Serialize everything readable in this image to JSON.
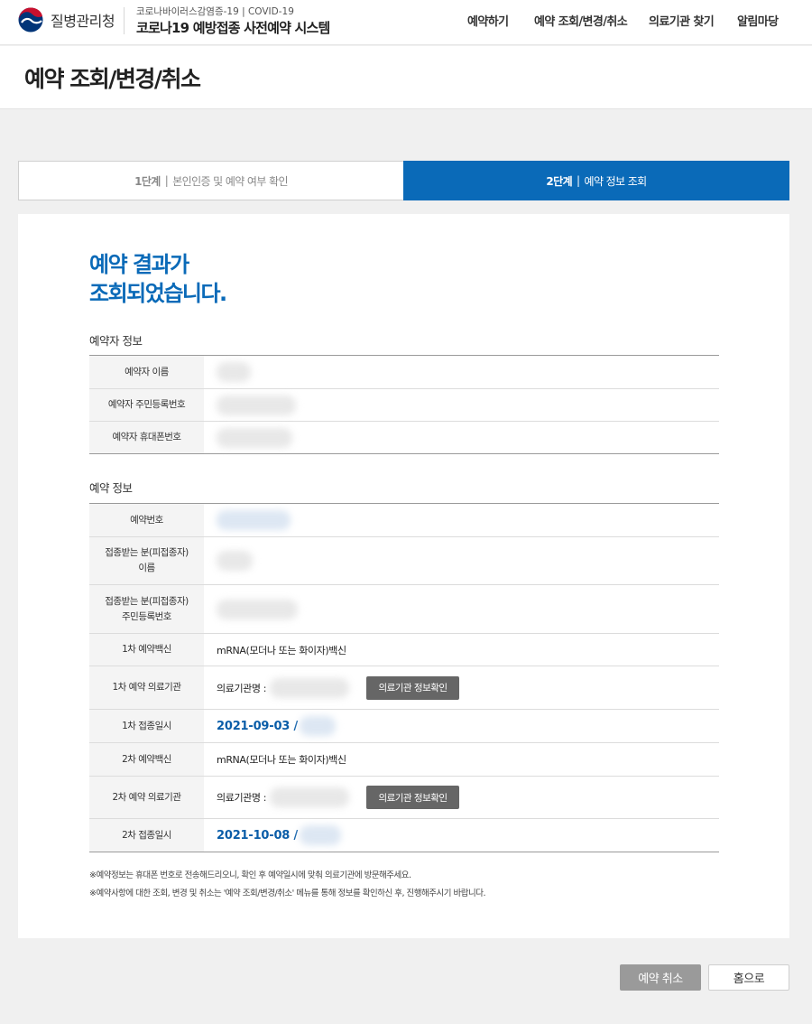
{
  "header": {
    "org_name": "질병관리청",
    "system_subtitle": "코로나바이러스감염증-19  |  COVID-19",
    "system_title": "코로나19 예방접종 사전예약 시스템",
    "nav": [
      "예약하기",
      "예약 조회/변경/취소",
      "의료기관 찾기",
      "알림마당"
    ]
  },
  "page_title": "예약 조회/변경/취소",
  "steps": [
    {
      "num": "1단계",
      "sep": "|",
      "label": "본인인증 및 예약 여부 확인",
      "active": false
    },
    {
      "num": "2단계",
      "sep": "|",
      "label": "예약 정보 조회",
      "active": true
    }
  ],
  "result": {
    "title_line1": "예약 결과가",
    "title_line2": "조회되었습니다."
  },
  "reserver": {
    "section": "예약자 정보",
    "rows": [
      {
        "label": "예약자 이름"
      },
      {
        "label": "예약자 주민등록번호"
      },
      {
        "label": "예약자 휴대폰번호"
      }
    ]
  },
  "reservation": {
    "section": "예약 정보",
    "number_label": "예약번호",
    "vaccinee_name_label_1": "접종받는 분(피접종자)",
    "vaccinee_name_label_2": "이름",
    "vaccinee_id_label_1": "접종받는 분(피접종자)",
    "vaccinee_id_label_2": "주민등록번호",
    "first_vaccine_label": "1차 예약백신",
    "first_vaccine": "mRNA(모더나 또는 화이자)백신",
    "first_clinic_label": "1차 예약 의료기관",
    "clinic_name_prefix": "의료기관명 :",
    "clinic_info_button": "의료기관 정보확인",
    "first_date_label": "1차 접종일시",
    "first_date": "2021-09-03 /",
    "second_vaccine_label": "2차 예약백신",
    "second_vaccine": "mRNA(모더나 또는 화이자)백신",
    "second_clinic_label": "2차 예약 의료기관",
    "second_date_label": "2차 접종일시",
    "second_date": "2021-10-08 /"
  },
  "notes": [
    "※예약정보는 휴대폰 번호로 전송해드리오니, 확인 후 예약일시에 맞춰 의료기관에 방문해주세요.",
    "※예약사항에 대한 조회, 변경 및 취소는 '예약 조회/변경/취소' 메뉴를 통해 정보를 확인하신 후, 진행해주시기 바랍니다."
  ],
  "buttons": {
    "cancel": "예약 취소",
    "home": "홈으로"
  },
  "colors": {
    "primary": "#0a6ab8",
    "logo_red": "#c8102e",
    "logo_blue": "#003478"
  }
}
